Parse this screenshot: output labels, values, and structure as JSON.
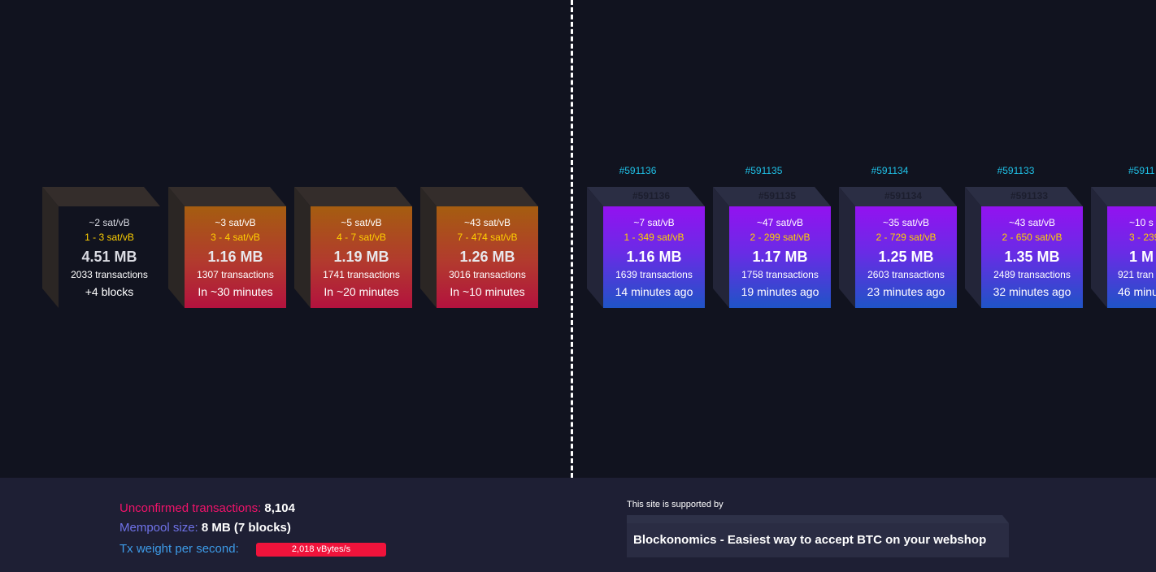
{
  "mempool_blocks": [
    {
      "fee": "~2 sat/vB",
      "range": "1 - 3 sat/vB",
      "size": "4.51 MB",
      "transactions": "2033 transactions",
      "time": "+4 blocks",
      "style": "plain"
    },
    {
      "fee": "~3 sat/vB",
      "range": "3 - 4 sat/vB",
      "size": "1.16 MB",
      "transactions": "1307 transactions",
      "time": "In ~30 minutes",
      "style": "grad"
    },
    {
      "fee": "~5 sat/vB",
      "range": "4 - 7 sat/vB",
      "size": "1.19 MB",
      "transactions": "1741 transactions",
      "time": "In ~20 minutes",
      "style": "grad"
    },
    {
      "fee": "~43 sat/vB",
      "range": "7 - 474 sat/vB",
      "size": "1.26 MB",
      "transactions": "3016 transactions",
      "time": "In ~10 minutes",
      "style": "grad"
    }
  ],
  "mined_blocks": [
    {
      "height": "#591136",
      "fee": "~7 sat/vB",
      "range": "1 - 349 sat/vB",
      "size": "1.16 MB",
      "transactions": "1639 transactions",
      "time": "14 minutes ago"
    },
    {
      "height": "#591135",
      "fee": "~47 sat/vB",
      "range": "2 - 299 sat/vB",
      "size": "1.17 MB",
      "transactions": "1758 transactions",
      "time": "19 minutes ago"
    },
    {
      "height": "#591134",
      "fee": "~35 sat/vB",
      "range": "2 - 729 sat/vB",
      "size": "1.25 MB",
      "transactions": "2603 transactions",
      "time": "23 minutes ago"
    },
    {
      "height": "#591133",
      "fee": "~43 sat/vB",
      "range": "2 - 650 sat/vB",
      "size": "1.35 MB",
      "transactions": "2489 transactions",
      "time": "32 minutes ago"
    },
    {
      "height": "#5911",
      "fee": "~10 s",
      "range": "3 - 239",
      "size": "1 M",
      "transactions": "921 tran",
      "time": "46 minu"
    }
  ],
  "stats": {
    "unconfirmed_label": "Unconfirmed transactions:",
    "unconfirmed_value": "8,104",
    "mempool_label": "Mempool size:",
    "mempool_value": "8 MB (7 blocks)",
    "tx_weight_label": "Tx weight per second:",
    "tx_weight_value": "2,018 vBytes/s"
  },
  "sponsor": {
    "supported_by": "This site is supported by",
    "name": "Blockonomics - Easiest way to accept BTC on your webshop"
  }
}
